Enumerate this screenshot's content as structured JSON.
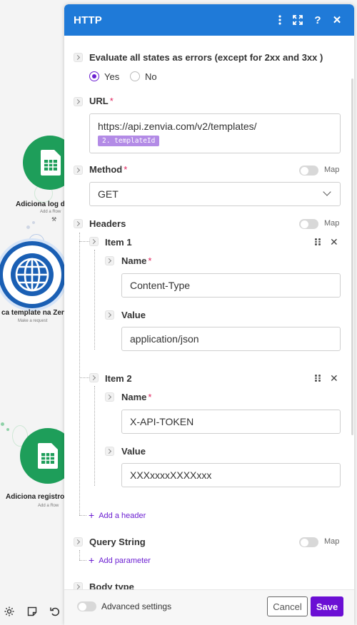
{
  "colors": {
    "accent": "#6b1ed1",
    "header": "#1f7ad8",
    "sheets_green": "#1e9e5a",
    "http_blue": "#1a5fb4",
    "tag": "#b38be6"
  },
  "canvas": {
    "nodes": [
      {
        "label": "Adiciona log d",
        "sub": "Add a Row",
        "icon": "google-sheets-icon"
      },
      {
        "label": "ca template na Zen",
        "sub": "Make a request",
        "icon": "globe-icon"
      },
      {
        "label": "Adiciona registro",
        "sub": "Add a Row",
        "icon": "google-sheets-icon"
      }
    ],
    "tools": [
      "settings-icon",
      "note-icon",
      "undo-icon"
    ]
  },
  "panel": {
    "title": "HTTP",
    "header_icons": [
      "more-vertical-icon",
      "expand-icon",
      "help-icon",
      "close-icon"
    ],
    "help_glyph": "?",
    "close_glyph": "✕",
    "evaluate": {
      "label": "Evaluate all states as errors (except for 2xx and 3xx )",
      "options": [
        {
          "label": "Yes",
          "selected": true
        },
        {
          "label": "No",
          "selected": false
        }
      ]
    },
    "url": {
      "label": "URL",
      "required_mark": "*",
      "value": "https://api.zenvia.com/v2/templates/",
      "tag": "2. templateId"
    },
    "method": {
      "label": "Method",
      "required_mark": "*",
      "value": "GET",
      "map_label": "Map"
    },
    "headers": {
      "label": "Headers",
      "map_label": "Map",
      "items": [
        {
          "title": "Item 1",
          "name_label": "Name",
          "name_value": "Content-Type",
          "value_label": "Value",
          "value_value": "application/json"
        },
        {
          "title": "Item 2",
          "name_label": "Name",
          "name_value": "X-API-TOKEN",
          "value_label": "Value",
          "value_value": "XXXxxxxXXXXxxx"
        }
      ],
      "add_label": "Add a header"
    },
    "query_string": {
      "label": "Query String",
      "map_label": "Map",
      "add_label": "Add parameter"
    },
    "body_type": {
      "label": "Body type"
    },
    "footer": {
      "advanced_label": "Advanced settings",
      "cancel_label": "Cancel",
      "save_label": "Save"
    }
  }
}
